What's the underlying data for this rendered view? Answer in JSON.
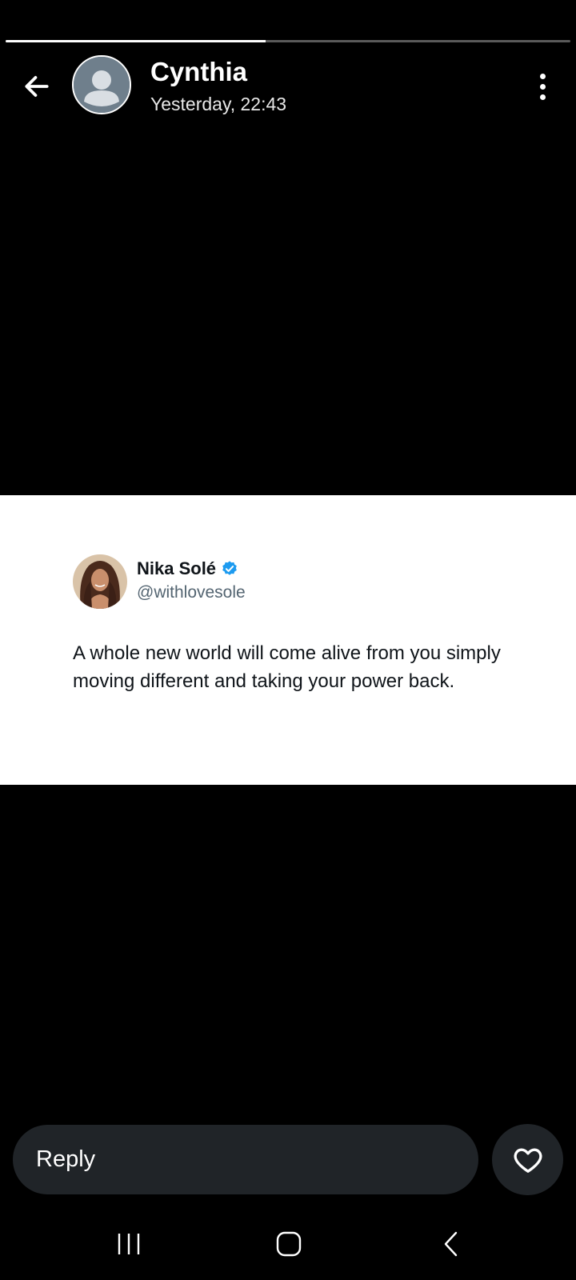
{
  "story": {
    "progress": 0.46
  },
  "header": {
    "contact_name": "Cynthia",
    "timestamp": "Yesterday, 22:43",
    "back_icon": "arrow-left-icon",
    "menu_icon": "more-vertical-icon"
  },
  "post": {
    "author": "Nika Solé",
    "verified": true,
    "handle": "@withlovesole",
    "text": "A whole new world will come alive from you simply moving different and taking your power back."
  },
  "reply": {
    "placeholder": "Reply",
    "like_icon": "heart-outline-icon"
  },
  "system_nav": {
    "buttons": [
      "recents-icon",
      "home-icon",
      "back-icon"
    ]
  },
  "colors": {
    "background": "#000000",
    "reply_bg": "#202428",
    "verified_badge": "#1d9bf0",
    "avatar_placeholder": "#6f7f8c"
  }
}
